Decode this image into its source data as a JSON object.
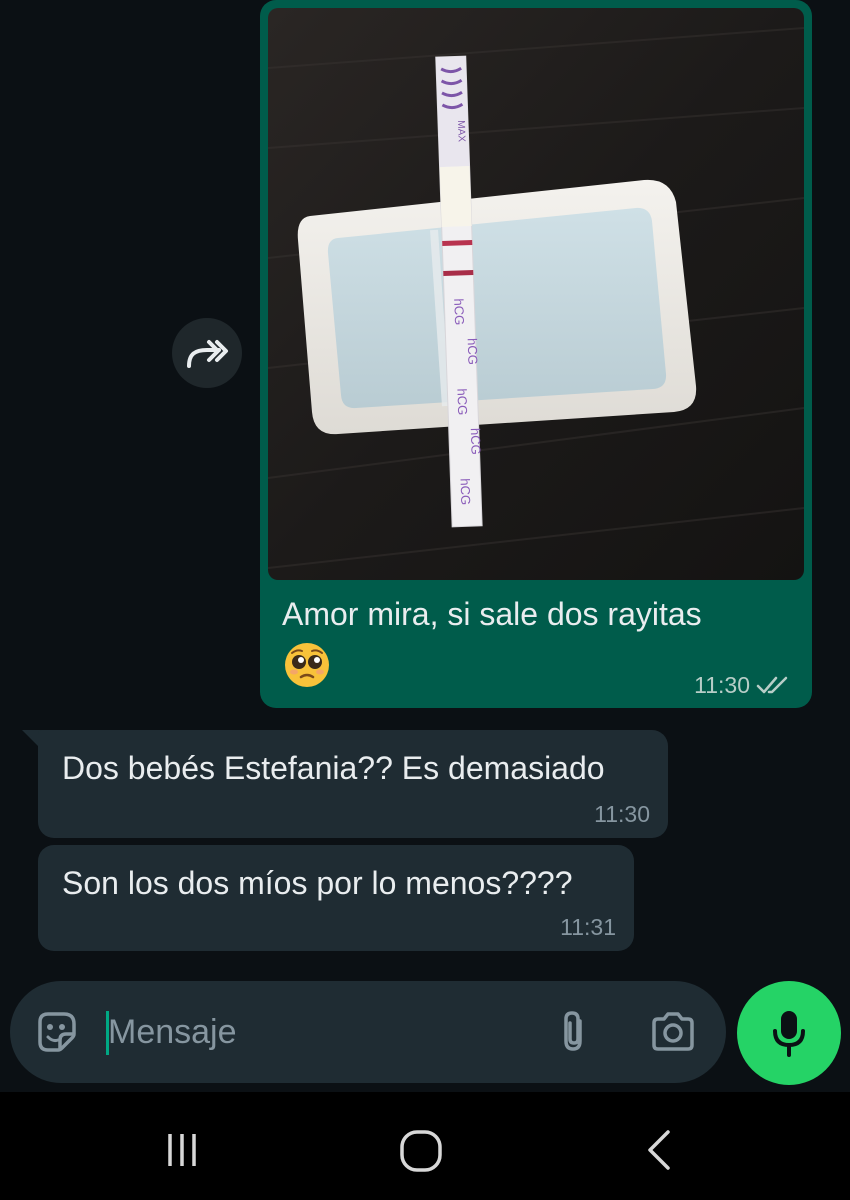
{
  "conversation": {
    "outgoing": [
      {
        "type": "image",
        "caption": "Amor mira, si sale dos rayitas",
        "emoji": "pleading-face-emoji",
        "time": "11:30",
        "status": "delivered-double-check",
        "photo_strip_labels": [
          "MAX",
          "hCG"
        ]
      }
    ],
    "incoming": [
      {
        "text": "Dos bebés Estefania?? Es demasiado",
        "time": "11:30"
      },
      {
        "text": "Son los dos míos por lo menos????",
        "time": "11:31"
      }
    ]
  },
  "composer": {
    "placeholder": "Mensaje",
    "icons": [
      "sticker-icon",
      "paperclip-icon",
      "camera-icon"
    ],
    "mic_icon": "microphone-icon"
  },
  "forward": {
    "icon": "forward-icon"
  },
  "navbar": {
    "icons": [
      "recent-apps-icon",
      "home-icon",
      "back-icon"
    ]
  },
  "colors": {
    "background": "#0b1014",
    "outgoing_bubble": "#005c4b",
    "incoming_bubble": "#1f2c33",
    "accent": "#25d366",
    "meta_text": "#8696a0"
  }
}
